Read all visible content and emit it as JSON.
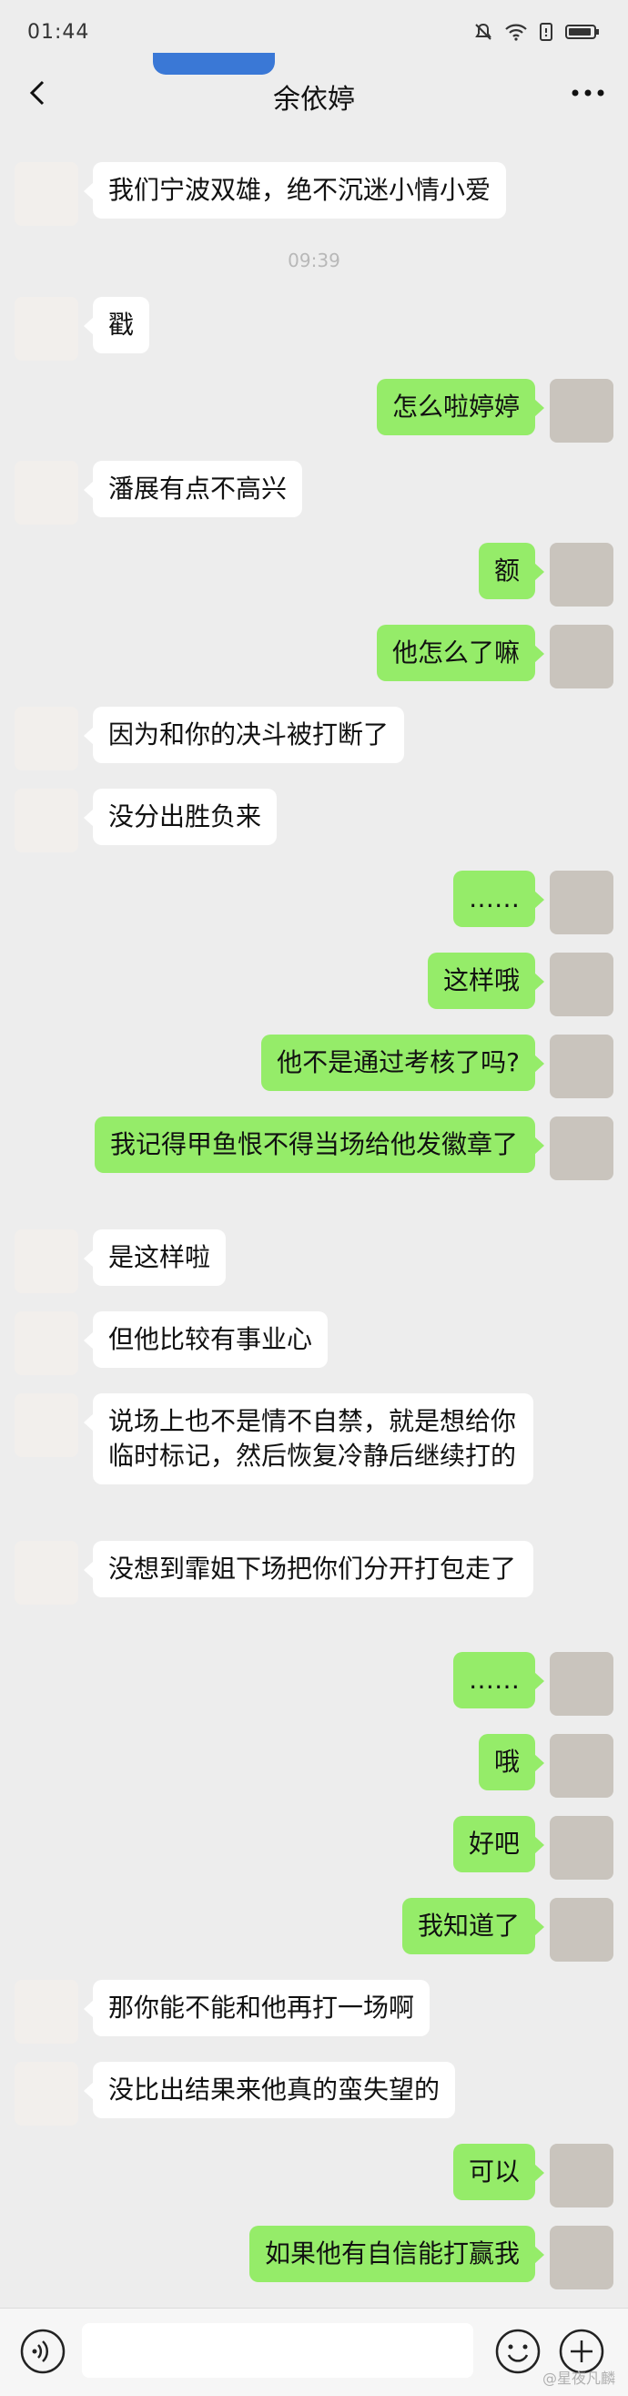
{
  "status_bar": {
    "time": "01:44"
  },
  "nav": {
    "title": "余依婷"
  },
  "timestamp": "09:39",
  "messages": [
    {
      "from": "her",
      "text": "我们宁波双雄，绝不沉迷小情小爱"
    },
    {
      "from": "her",
      "text": "戳"
    },
    {
      "from": "me",
      "text": "怎么啦婷婷"
    },
    {
      "from": "her",
      "text": "潘展有点不高兴"
    },
    {
      "from": "me",
      "text": "额"
    },
    {
      "from": "me",
      "text": "他怎么了嘛"
    },
    {
      "from": "her",
      "text": "因为和你的决斗被打断了"
    },
    {
      "from": "her",
      "text": "没分出胜负来"
    },
    {
      "from": "me",
      "text": "……"
    },
    {
      "from": "me",
      "text": "这样哦"
    },
    {
      "from": "me",
      "text": "他不是通过考核了吗?"
    },
    {
      "from": "me",
      "text": "我记得甲鱼恨不得当场给他发徽章了"
    },
    {
      "from": "her",
      "text": "是这样啦"
    },
    {
      "from": "her",
      "text": "但他比较有事业心"
    },
    {
      "from": "her",
      "text": "说场上也不是情不自禁，就是想给你临时标记，然后恢复冷静后继续打的"
    },
    {
      "from": "her",
      "text": "没想到霏姐下场把你们分开打包走了"
    },
    {
      "from": "me",
      "text": "……"
    },
    {
      "from": "me",
      "text": "哦"
    },
    {
      "from": "me",
      "text": "好吧"
    },
    {
      "from": "me",
      "text": "我知道了"
    },
    {
      "from": "her",
      "text": "那你能不能和他再打一场啊"
    },
    {
      "from": "her",
      "text": "没比出结果来他真的蛮失望的"
    },
    {
      "from": "me",
      "text": "可以"
    },
    {
      "from": "me",
      "text": "如果他有自信能打赢我"
    }
  ],
  "credit": "@星夜凡麟",
  "colors": {
    "bubble_out": "#95ec69",
    "bubble_in": "#ffffff",
    "background": "#ededed"
  }
}
